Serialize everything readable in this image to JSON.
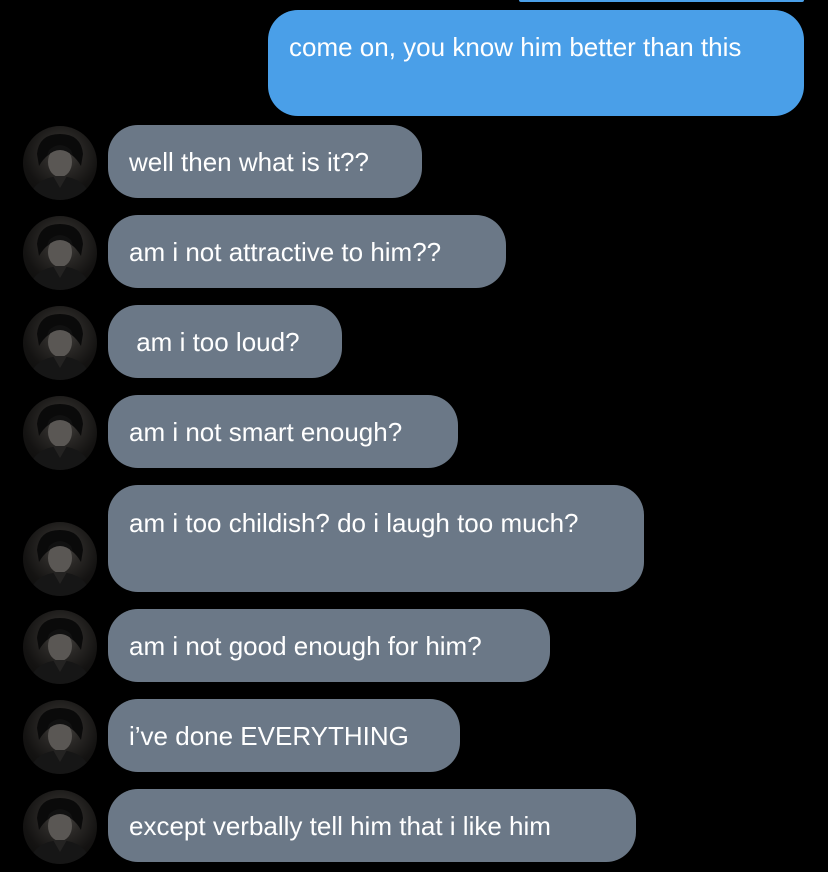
{
  "colors": {
    "background": "#000000",
    "sent_bubble": "#4a9fe8",
    "received_bubble": "#6b7887",
    "text": "#ffffff"
  },
  "conversation": {
    "sent_messages": [
      {
        "text": "come on, you know him better than this"
      }
    ],
    "received_messages": [
      {
        "text": "well then what is it??",
        "avatar": "contact-avatar"
      },
      {
        "text": "am i not attractive to him??",
        "avatar": "contact-avatar"
      },
      {
        "text": " am i too loud?",
        "avatar": "contact-avatar"
      },
      {
        "text": "am i not smart enough?",
        "avatar": "contact-avatar"
      },
      {
        "text": "am i too childish? do i laugh too much?",
        "avatar": "contact-avatar"
      },
      {
        "text": "am i not good enough for him?",
        "avatar": "contact-avatar"
      },
      {
        "text": "i’ve done EVERYTHING",
        "avatar": "contact-avatar"
      },
      {
        "text": "except verbally tell him that i like him",
        "avatar": "contact-avatar"
      }
    ]
  }
}
